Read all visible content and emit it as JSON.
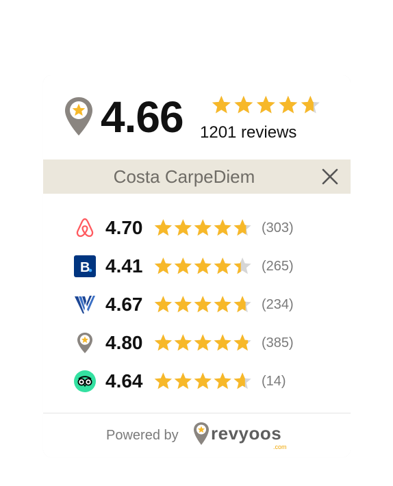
{
  "summary": {
    "score": "4.66",
    "rating_value": 4.66,
    "reviews_label": "1201 reviews"
  },
  "property": {
    "name": "Costa CarpeDiem"
  },
  "platforms": [
    {
      "id": "airbnb",
      "icon": "airbnb-icon",
      "score": "4.70",
      "rating": 4.7,
      "count": "(303)",
      "color": "#ff5a5f"
    },
    {
      "id": "booking",
      "icon": "booking-icon",
      "score": "4.41",
      "rating": 4.41,
      "count": "(265)",
      "color": "#003580"
    },
    {
      "id": "vrbo",
      "icon": "vrbo-icon",
      "score": "4.67",
      "rating": 4.67,
      "count": "(234)",
      "color": "#1c4695"
    },
    {
      "id": "revyoos",
      "icon": "revyoos-pin-icon",
      "score": "4.80",
      "rating": 4.8,
      "count": "(385)",
      "color": "#8a8580"
    },
    {
      "id": "tripadvisor",
      "icon": "tripadvisor-icon",
      "score": "4.64",
      "rating": 4.64,
      "count": "(14)",
      "color": "#34e0a1"
    }
  ],
  "footer": {
    "powered_label": "Powered by",
    "brand": "revyoos",
    "brand_suffix": ".com"
  },
  "colors": {
    "star_fill": "#f7b829",
    "star_empty": "#d6d6d6",
    "namebar_bg": "#ebe7dc",
    "pin_gray": "#8a8580"
  }
}
